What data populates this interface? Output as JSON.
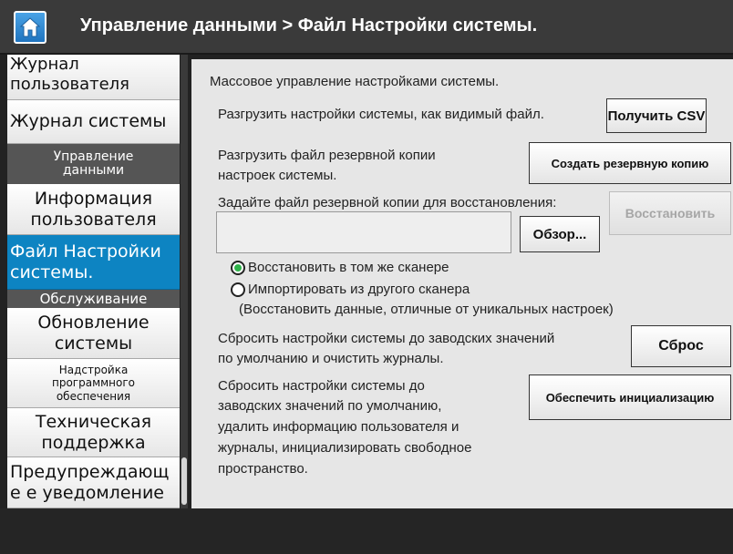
{
  "header": {
    "title": "Управление данными > Файл Настройки системы.",
    "home_icon": "home-icon"
  },
  "sidebar": {
    "items": [
      {
        "label": "Журнал пользователя"
      },
      {
        "label": "Журнал системы"
      },
      {
        "label": "Управление данными",
        "category": true
      },
      {
        "label": "Информация пользователя"
      },
      {
        "label": "Файл Настройки системы.",
        "selected": true
      },
      {
        "label": "Обслуживание",
        "category": true
      },
      {
        "label": "Обновление системы"
      },
      {
        "label": "Надстройка программного обеспечения"
      },
      {
        "label": "Техническая поддержка"
      },
      {
        "label": "Предупреждающе е уведомление"
      }
    ]
  },
  "main": {
    "intro": "Массовое управление настройками системы.",
    "csv_text": "Разгрузить настройки системы, как видимый файл.",
    "csv_button": "Получить CSV",
    "backup_text_1": "Разгрузить файл резервной копии",
    "backup_text_2": "настроек системы.",
    "backup_button": "Создать резервную копию",
    "restore_label": "Задайте файл резервной копии для восстановления:",
    "file_value": "",
    "restore_button": "Восстановить",
    "browse_button": "Обзор...",
    "radio_same": "Восстановить в том же сканере",
    "radio_other": "Импортировать из другого сканера",
    "radio_other_note": "(Восстановить данные, отличные от уникальных настроек)",
    "reset_text_1": "Сбросить настройки системы до заводских значений",
    "reset_text_2": "по умолчанию и очистить журналы.",
    "reset_button": "Сброс",
    "init_text_1": "Сбросить настройки системы до",
    "init_text_2": "заводских значений по умолчанию,",
    "init_text_3": "удалить информацию пользователя и",
    "init_text_4": "журналы, инициализировать свободное",
    "init_text_5": "пространство.",
    "init_button": "Обеспечить инициализацию"
  },
  "colors": {
    "header_bg": "#3a3a3a",
    "selected_bg": "#0d84c2",
    "category_bg": "#555555",
    "radio_on": "#2fb34a"
  }
}
